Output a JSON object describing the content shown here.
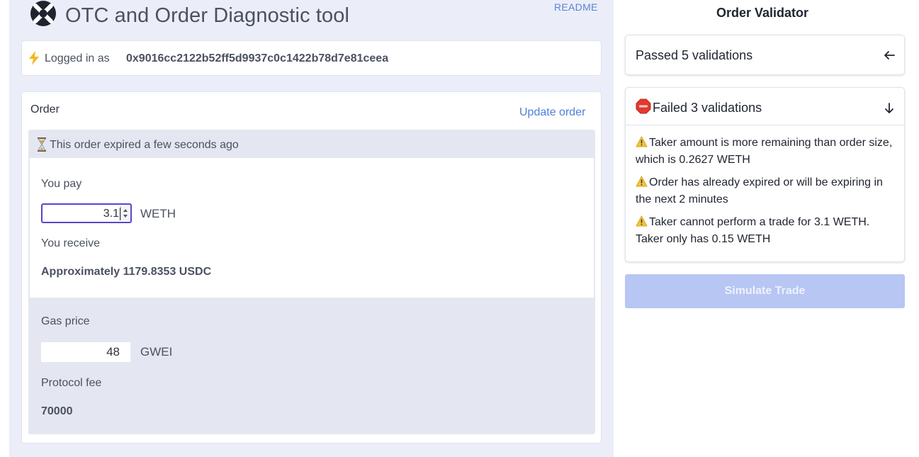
{
  "header": {
    "title": "OTC and Order Diagnostic tool",
    "readme": "README"
  },
  "login": {
    "label": "Logged in as",
    "address": "0x9016cc2122b52ff5d9937c0c1422b78d7e81ceea"
  },
  "order": {
    "title": "Order",
    "update_label": "Update order",
    "expired_text": "This order expired a few seconds ago",
    "pay_label": "You pay",
    "pay_value": "3.1",
    "pay_unit": "WETH",
    "receive_label": "You receive",
    "receive_value": "Approximately 1179.8353 USDC",
    "gas_label": "Gas price",
    "gas_value": "48",
    "gas_unit": "GWEI",
    "fee_label": "Protocol fee",
    "fee_value": "70000"
  },
  "validator": {
    "title": "Order Validator",
    "passed_label": "Passed 5 validations",
    "failed_label": "Failed 3 validations",
    "failures": [
      "Taker amount is more remaining than order size, which is 0.2627 WETH",
      "Order has already expired or will be expiring in the next 2 minutes",
      "Taker cannot perform a trade for 3.1 WETH. Taker only has 0.15 WETH"
    ],
    "simulate_label": "Simulate Trade"
  },
  "icons": {
    "logo": "0x-logo-icon",
    "bolt": "lightning-icon",
    "hourglass": "hourglass-icon",
    "stop": "stop-sign-icon",
    "warning": "warning-icon",
    "collapsed_arrow": "arrow-left-icon",
    "expanded_arrow": "arrow-down-icon"
  },
  "colors": {
    "accent_link": "#4f7fd6",
    "input_focus": "#5b44c9",
    "button_disabled": "#b7c6f2",
    "panel_bg": "#ebeef8"
  }
}
